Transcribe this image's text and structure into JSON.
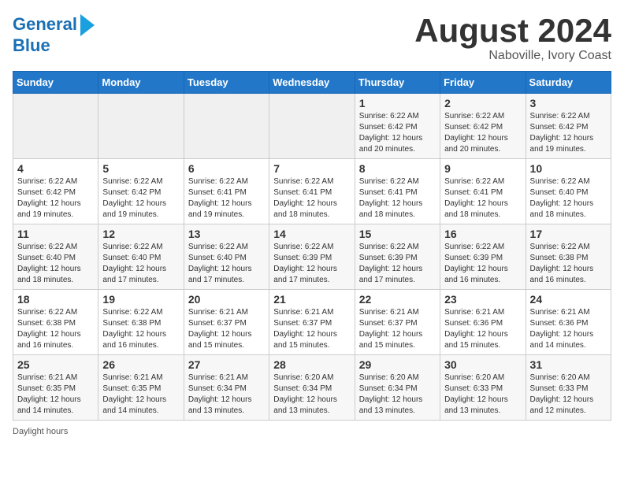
{
  "logo": {
    "line1": "General",
    "line2": "Blue",
    "tagline": "Daylight hours"
  },
  "title": "August 2024",
  "subtitle": "Naboville, Ivory Coast",
  "days_of_week": [
    "Sunday",
    "Monday",
    "Tuesday",
    "Wednesday",
    "Thursday",
    "Friday",
    "Saturday"
  ],
  "weeks": [
    [
      {
        "day": "",
        "info": ""
      },
      {
        "day": "",
        "info": ""
      },
      {
        "day": "",
        "info": ""
      },
      {
        "day": "",
        "info": ""
      },
      {
        "day": "1",
        "info": "Sunrise: 6:22 AM\nSunset: 6:42 PM\nDaylight: 12 hours and 20 minutes."
      },
      {
        "day": "2",
        "info": "Sunrise: 6:22 AM\nSunset: 6:42 PM\nDaylight: 12 hours and 20 minutes."
      },
      {
        "day": "3",
        "info": "Sunrise: 6:22 AM\nSunset: 6:42 PM\nDaylight: 12 hours and 19 minutes."
      }
    ],
    [
      {
        "day": "4",
        "info": "Sunrise: 6:22 AM\nSunset: 6:42 PM\nDaylight: 12 hours and 19 minutes."
      },
      {
        "day": "5",
        "info": "Sunrise: 6:22 AM\nSunset: 6:42 PM\nDaylight: 12 hours and 19 minutes."
      },
      {
        "day": "6",
        "info": "Sunrise: 6:22 AM\nSunset: 6:41 PM\nDaylight: 12 hours and 19 minutes."
      },
      {
        "day": "7",
        "info": "Sunrise: 6:22 AM\nSunset: 6:41 PM\nDaylight: 12 hours and 18 minutes."
      },
      {
        "day": "8",
        "info": "Sunrise: 6:22 AM\nSunset: 6:41 PM\nDaylight: 12 hours and 18 minutes."
      },
      {
        "day": "9",
        "info": "Sunrise: 6:22 AM\nSunset: 6:41 PM\nDaylight: 12 hours and 18 minutes."
      },
      {
        "day": "10",
        "info": "Sunrise: 6:22 AM\nSunset: 6:40 PM\nDaylight: 12 hours and 18 minutes."
      }
    ],
    [
      {
        "day": "11",
        "info": "Sunrise: 6:22 AM\nSunset: 6:40 PM\nDaylight: 12 hours and 18 minutes."
      },
      {
        "day": "12",
        "info": "Sunrise: 6:22 AM\nSunset: 6:40 PM\nDaylight: 12 hours and 17 minutes."
      },
      {
        "day": "13",
        "info": "Sunrise: 6:22 AM\nSunset: 6:40 PM\nDaylight: 12 hours and 17 minutes."
      },
      {
        "day": "14",
        "info": "Sunrise: 6:22 AM\nSunset: 6:39 PM\nDaylight: 12 hours and 17 minutes."
      },
      {
        "day": "15",
        "info": "Sunrise: 6:22 AM\nSunset: 6:39 PM\nDaylight: 12 hours and 17 minutes."
      },
      {
        "day": "16",
        "info": "Sunrise: 6:22 AM\nSunset: 6:39 PM\nDaylight: 12 hours and 16 minutes."
      },
      {
        "day": "17",
        "info": "Sunrise: 6:22 AM\nSunset: 6:38 PM\nDaylight: 12 hours and 16 minutes."
      }
    ],
    [
      {
        "day": "18",
        "info": "Sunrise: 6:22 AM\nSunset: 6:38 PM\nDaylight: 12 hours and 16 minutes."
      },
      {
        "day": "19",
        "info": "Sunrise: 6:22 AM\nSunset: 6:38 PM\nDaylight: 12 hours and 16 minutes."
      },
      {
        "day": "20",
        "info": "Sunrise: 6:21 AM\nSunset: 6:37 PM\nDaylight: 12 hours and 15 minutes."
      },
      {
        "day": "21",
        "info": "Sunrise: 6:21 AM\nSunset: 6:37 PM\nDaylight: 12 hours and 15 minutes."
      },
      {
        "day": "22",
        "info": "Sunrise: 6:21 AM\nSunset: 6:37 PM\nDaylight: 12 hours and 15 minutes."
      },
      {
        "day": "23",
        "info": "Sunrise: 6:21 AM\nSunset: 6:36 PM\nDaylight: 12 hours and 15 minutes."
      },
      {
        "day": "24",
        "info": "Sunrise: 6:21 AM\nSunset: 6:36 PM\nDaylight: 12 hours and 14 minutes."
      }
    ],
    [
      {
        "day": "25",
        "info": "Sunrise: 6:21 AM\nSunset: 6:35 PM\nDaylight: 12 hours and 14 minutes."
      },
      {
        "day": "26",
        "info": "Sunrise: 6:21 AM\nSunset: 6:35 PM\nDaylight: 12 hours and 14 minutes."
      },
      {
        "day": "27",
        "info": "Sunrise: 6:21 AM\nSunset: 6:34 PM\nDaylight: 12 hours and 13 minutes."
      },
      {
        "day": "28",
        "info": "Sunrise: 6:20 AM\nSunset: 6:34 PM\nDaylight: 12 hours and 13 minutes."
      },
      {
        "day": "29",
        "info": "Sunrise: 6:20 AM\nSunset: 6:34 PM\nDaylight: 12 hours and 13 minutes."
      },
      {
        "day": "30",
        "info": "Sunrise: 6:20 AM\nSunset: 6:33 PM\nDaylight: 12 hours and 13 minutes."
      },
      {
        "day": "31",
        "info": "Sunrise: 6:20 AM\nSunset: 6:33 PM\nDaylight: 12 hours and 12 minutes."
      }
    ]
  ]
}
